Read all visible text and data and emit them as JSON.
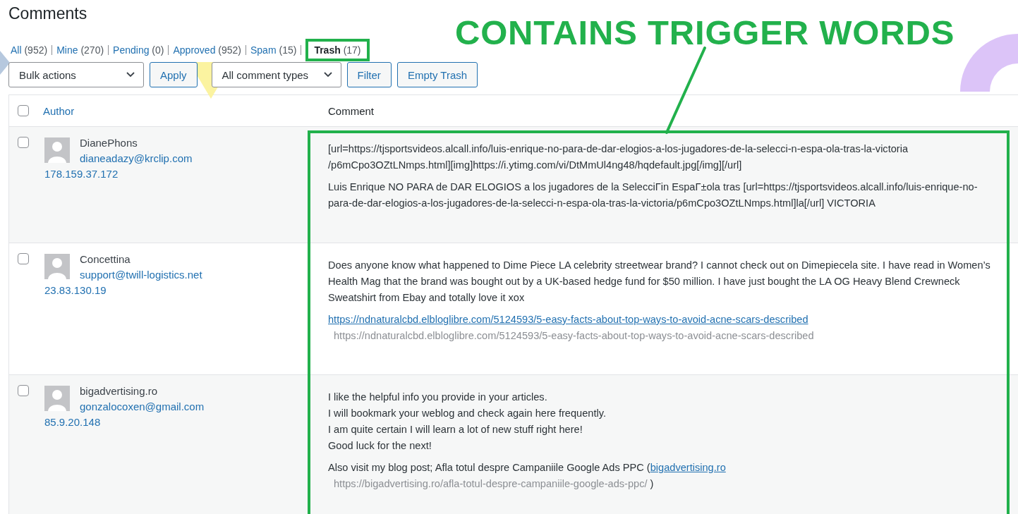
{
  "title": "Comments",
  "filters": [
    {
      "label": "All",
      "count": "(952)",
      "selected": false
    },
    {
      "label": "Mine",
      "count": "(270)",
      "selected": false
    },
    {
      "label": "Pending",
      "count": "(0)",
      "selected": false
    },
    {
      "label": "Approved",
      "count": "(952)",
      "selected": false
    },
    {
      "label": "Spam",
      "count": "(15)",
      "selected": false
    },
    {
      "label": "Trash",
      "count": "(17)",
      "selected": true
    }
  ],
  "toolbar": {
    "bulk_actions": "Bulk actions",
    "apply": "Apply",
    "comment_types": "All comment types",
    "filter": "Filter",
    "empty_trash": "Empty Trash"
  },
  "table": {
    "select_all_checked": false,
    "columns": [
      {
        "label": "Author"
      },
      {
        "label": "Comment"
      }
    ],
    "rows": [
      {
        "checked": false,
        "author": "DianePhons",
        "email": "dianeadazy@krclip.com",
        "ip": "178.159.37.172",
        "blocks": [
          {
            "parts": [
              {
                "kind": "text",
                "text": "[url=https://tjsportsvideos.alcall.info/luis-enrique-no-para-de-dar-elogios-a-los-jugadores-de-la-selecci-n-espa-ola-tras-la-victoria /p6mCpo3OZtLNmps.html][img]https://i.ytimg.com/vi/DtMmUl4ng48/hqdefault.jpg[/img][/url]"
              }
            ]
          },
          {
            "parts": [
              {
                "kind": "text",
                "text": "Luis Enrique NO PARA de DAR ELOGIOS a los jugadores de la SelecciΓin EspaΓ±ola tras [url=https://tjsportsvideos.alcall.info/luis-enrique-no-para-de-dar-elogios-a-los-jugadores-de-la-selecci-n-espa-ola-tras-la-victoria/p6mCpo3OZtLNmps.html]la[/url] VICTORIA"
              }
            ]
          }
        ]
      },
      {
        "checked": false,
        "author": "Concettina",
        "email": "support@twill-logistics.net",
        "ip": "23.83.130.19",
        "blocks": [
          {
            "parts": [
              {
                "kind": "text",
                "text": "Does anyone know what happened to Dime Piece LA celebrity streetwear brand? I cannot check out on Dimepiecela site. I have read in Women’s Health Mag that the brand was bought out by a UK-based hedge fund for $50 million. I have just bought the LA OG Heavy Blend Crewneck Sweatshirt from Ebay and totally love it xox"
              }
            ]
          },
          {
            "parts": [
              {
                "kind": "link",
                "text": "https://ndnaturalcbd.elbloglibre.com/5124593/5-easy-facts-about-top-ways-to-avoid-acne-scars-described"
              },
              {
                "kind": "break"
              },
              {
                "kind": "note",
                "text": "https://ndnaturalcbd.elbloglibre.com/5124593/5-easy-facts-about-top-ways-to-avoid-acne-scars-described"
              }
            ]
          }
        ]
      },
      {
        "checked": false,
        "author": "bigadvertising.ro",
        "email": "gonzalocoxen@gmail.com",
        "ip": "85.9.20.148",
        "blocks": [
          {
            "parts": [
              {
                "kind": "line",
                "text": "I like the helpful info you provide in your articles."
              },
              {
                "kind": "line",
                "text": "I will bookmark your weblog and check again here frequently."
              },
              {
                "kind": "line",
                "text": "I am quite certain I will learn a lot of new stuff right here!"
              },
              {
                "kind": "line",
                "text": "Good luck for the next!"
              }
            ]
          },
          {
            "parts": [
              {
                "kind": "text",
                "text": "Also visit my blog post; Afla totul despre Campaniile Google Ads PPC ("
              },
              {
                "kind": "link",
                "text": "bigadvertising.ro"
              },
              {
                "kind": "break"
              },
              {
                "kind": "note",
                "text": "https://bigadvertising.ro/afla-totul-despre-campaniile-google-ads-ppc/"
              },
              {
                "kind": "text",
                "text": " )"
              }
            ]
          }
        ]
      }
    ]
  },
  "annotation": {
    "headline": "CONTAINS TRIGGER WORDS"
  }
}
